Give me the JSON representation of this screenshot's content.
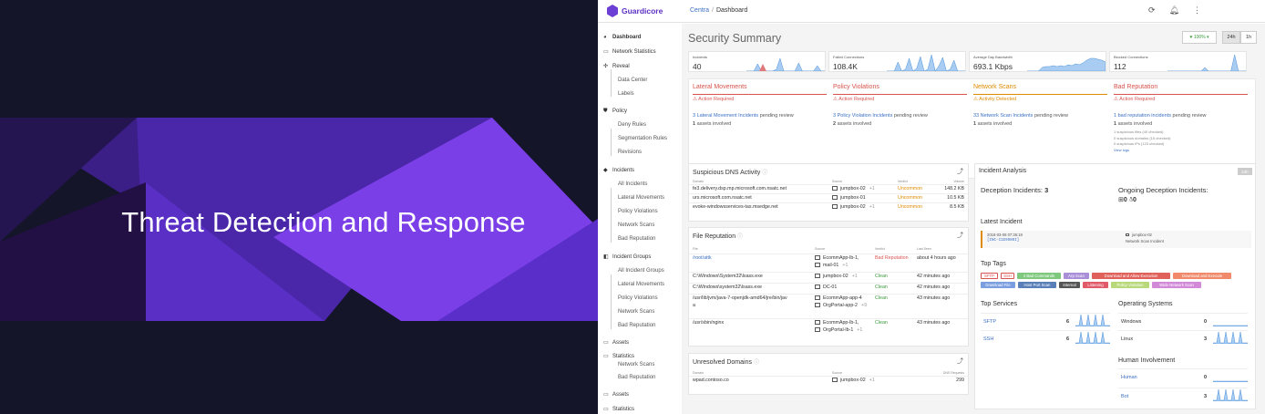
{
  "hero": {
    "title": "Threat Detection and Response"
  },
  "app": {
    "brand": "Guardicore",
    "breadcrumb": {
      "root": "Centra",
      "current": "Dashboard"
    }
  },
  "sidebar": {
    "items": [
      {
        "label": "Dashboard",
        "icon": "dashboard-icon"
      },
      {
        "label": "Network Statistics",
        "icon": "monitor-icon"
      },
      {
        "label": "Reveal",
        "icon": "reveal-icon"
      },
      {
        "label": "Data Center"
      },
      {
        "label": "Labels"
      },
      {
        "label": "Policy",
        "icon": "shield-icon"
      },
      {
        "label": "Deny Rules"
      },
      {
        "label": "Segmentation Rules"
      },
      {
        "label": "Revisions"
      },
      {
        "label": "Incidents",
        "icon": "diamond-icon"
      },
      {
        "label": "All Incidents"
      },
      {
        "label": "Lateral Movements"
      },
      {
        "label": "Policy Violations"
      },
      {
        "label": "Network Scans"
      },
      {
        "label": "Bad Reputation"
      },
      {
        "label": "Incident Groups",
        "icon": "group-icon"
      },
      {
        "label": "All Incident Groups"
      },
      {
        "label": "Lateral Movements"
      },
      {
        "label": "Policy Violations"
      },
      {
        "label": "Network Scans"
      },
      {
        "label": "Bad Reputation"
      },
      {
        "label": "Assets",
        "icon": "monitor-icon"
      },
      {
        "label": "Statistics",
        "icon": "monitor-icon"
      },
      {
        "label": "Network Scans"
      },
      {
        "label": "Bad Reputation"
      },
      {
        "label": "Assets",
        "icon": "monitor-icon"
      },
      {
        "label": "Statistics",
        "icon": "monitor-icon"
      }
    ]
  },
  "summary": {
    "title": "Security Summary",
    "health": "♥ 100% ▾",
    "range_24h": "24h",
    "range_1h": "1h",
    "stats": [
      {
        "label": "Incidents",
        "value": "40"
      },
      {
        "label": "Failed Connections",
        "value": "108.4K"
      },
      {
        "label": "Average Day Bandwidth",
        "value": "693.1 Kbps"
      },
      {
        "label": "Blocked Connections",
        "value": "112"
      }
    ]
  },
  "alerts": [
    {
      "title": "Lateral Movements",
      "status": "⚠ Action Required",
      "count": "3",
      "link": "Lateral Movement Incidents",
      "suffix": " pending review",
      "assets_count": "1",
      "assets_text": " assets involved"
    },
    {
      "title": "Policy Violations",
      "status": "⚠ Action Required",
      "count": "3",
      "link": "Policy Violation Incidents",
      "suffix": " pending review",
      "assets_count": "2",
      "assets_text": " assets involved"
    },
    {
      "title": "Network Scans",
      "status": "⚠ Activity Detected",
      "count": "33",
      "link": "Network Scan Incidents",
      "suffix": " pending review",
      "assets_count": "1",
      "assets_text": " assets involved"
    },
    {
      "title": "Bad Reputation",
      "status": "⚠ Action Required",
      "count": "1",
      "link": "bad reputation incidents",
      "suffix": " pending review",
      "assets_count": "1",
      "assets_text": " assets involved",
      "extra": [
        "1 suspicious files (40 checked)",
        "0 suspicious domains (15 checked)",
        "0 suspicious IPs (123 checked)",
        "View logs"
      ]
    }
  ],
  "dns": {
    "title": "Suspicious DNS Activity",
    "cols": [
      "Domain",
      "Source",
      "Verdict",
      "Volume"
    ],
    "rows": [
      {
        "domain": "fe3.delivery.dsp.mp.microsoft.com.nsatc.net",
        "source": "jumpbox-02",
        "more": "+1",
        "verdict": "Uncommon",
        "volume": "148.2 KB"
      },
      {
        "domain": "urs.microsoft.com.nsatc.net",
        "source": "jumpbox-01",
        "more": "",
        "verdict": "Uncommon",
        "volume": "10.5 KB"
      },
      {
        "domain": "evoke-windowsservices-tas.msedge.net",
        "source": "jumpbox-02",
        "more": "+1",
        "verdict": "Uncommon",
        "volume": "8.5 KB"
      }
    ]
  },
  "files": {
    "title": "File Reputation",
    "cols": [
      "File",
      "Source",
      "Verdict",
      "Last Seen"
    ],
    "rows": [
      {
        "file": "/root/attk",
        "source": "EcommApp-lb-1,",
        "source2": "mail-01",
        "more": "+1",
        "verdict": "Bad Reputation",
        "seen": "about 4 hours ago"
      },
      {
        "file": "C:\\Windows\\System32\\lsass.exe",
        "source": "jumpbox-02",
        "source2": "",
        "more": "+1",
        "verdict": "Clean",
        "seen": "42 minutes ago"
      },
      {
        "file": "C:\\Windows\\system32\\lsass.exe",
        "source": "DC-01",
        "source2": "",
        "more": "",
        "verdict": "Clean",
        "seen": "42 minutes ago"
      },
      {
        "file": "/usr/lib/jvm/java-7-openjdk-amd64/jre/bin/jav",
        "file2": "a",
        "source": "EcommApp-app-4",
        "source2": "OrgPortal-app-2",
        "more": "+9",
        "verdict": "Clean",
        "seen": "43 minutes ago"
      },
      {
        "file": "/usr/sbin/nginx",
        "source": "EcommApp-lb-1,",
        "source2": "OrgPortal-lb-1",
        "more": "+1",
        "verdict": "Clean",
        "seen": "43 minutes ago"
      }
    ]
  },
  "domains": {
    "title": "Unresolved Domains",
    "cols": [
      "Domain",
      "Source",
      "DNS Requests"
    ],
    "rows": [
      {
        "domain": "wpad.contoso.co",
        "source": "jumpbox-02",
        "more": "+1",
        "requests": "299"
      }
    ]
  },
  "incidents": {
    "title": "Incident Analysis",
    "badge": "24h",
    "deception_label": "Deception Incidents:",
    "deception_count": "3",
    "ongoing_label": "Ongoing Deception Incidents:",
    "ongoing_win": "0",
    "ongoing_linux": "0",
    "latest_title": "Latest Incident",
    "latest_time": "2018-03-08 07:36:18",
    "latest_id": "INC-C1E9980I",
    "latest_source": "jumpbox-02",
    "latest_type": "Network Scan Incident",
    "tags_title": "Top Tags",
    "tags": [
      {
        "label": "SFTP",
        "color": "#d9534f",
        "outline": true
      },
      {
        "label": "SSH",
        "color": "#d9534f",
        "outline": true
      },
      {
        "label": "4 Bad Commands",
        "color": "#7fc97f"
      },
      {
        "label": "Arp Scan",
        "color": "#a98fd8"
      },
      {
        "label": "Download and Allow Execution",
        "color": "#e0605a"
      },
      {
        "label": "Download and Execute",
        "color": "#f08a6a"
      },
      {
        "label": "Download File",
        "color": "#7a9ee0"
      },
      {
        "label": "Host Port Scan",
        "color": "#5a7fb8"
      },
      {
        "label": "Internal",
        "color": "#555555"
      },
      {
        "label": "Listening",
        "color": "#e05a6a"
      },
      {
        "label": "Policy Violation",
        "color": "#b7d97a"
      },
      {
        "label": "Wide Network Scan",
        "color": "#d28ad8"
      }
    ],
    "services_title": "Top Services",
    "services": [
      {
        "name": "SFTP",
        "count": "6"
      },
      {
        "name": "SSH",
        "count": "6"
      }
    ],
    "os_title": "Operating Systems",
    "os": [
      {
        "name": "Windows",
        "count": "0"
      },
      {
        "name": "Linux",
        "count": "3"
      }
    ],
    "human_title": "Human Involvement",
    "human": [
      {
        "name": "Human",
        "count": "0"
      },
      {
        "name": "Bot",
        "count": "3"
      }
    ]
  },
  "colors": {
    "accent": "#5b2fc4",
    "link": "#3a6fc2",
    "danger": "#d9534f",
    "warning": "#e08a00",
    "success": "#3a9a3a",
    "spark": "#4a90d9"
  }
}
